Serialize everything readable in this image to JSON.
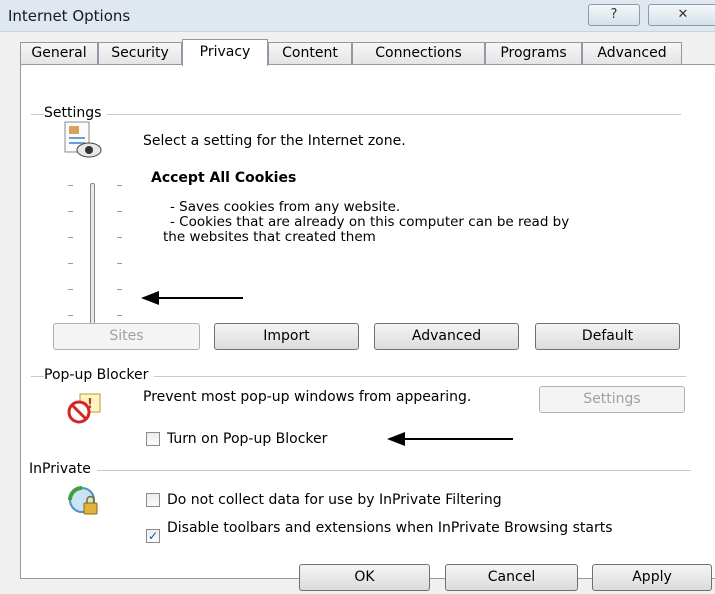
{
  "window": {
    "title": "Internet Options",
    "help_icon": "question-mark",
    "close_icon": "close-x"
  },
  "tabs": [
    "General",
    "Security",
    "Privacy",
    "Content",
    "Connections",
    "Programs",
    "Advanced"
  ],
  "active_tab": "Privacy",
  "settings": {
    "group_label": "Settings",
    "zone_prompt": "Select a setting for the Internet zone.",
    "level_title": "Accept All Cookies",
    "level_description": [
      "- Saves cookies from any website.",
      "- Cookies that are already on this computer can be read by",
      "the websites that created them"
    ],
    "slider": {
      "position": "bottom",
      "level_index": 0,
      "total_levels": 6
    },
    "buttons": {
      "sites": "Sites",
      "import": "Import",
      "advanced": "Advanced",
      "default": "Default"
    }
  },
  "popup_blocker": {
    "group_label": "Pop-up Blocker",
    "description": "Prevent most pop-up windows from appearing.",
    "settings_button": "Settings",
    "checkbox_label": "Turn on Pop-up Blocker",
    "checked": false
  },
  "inprivate": {
    "group_label": "InPrivate",
    "filtering_label": "Do not collect data for use by InPrivate Filtering",
    "filtering_checked": false,
    "toolbars_label": "Disable toolbars and extensions when InPrivate Browsing starts",
    "toolbars_checked": true
  },
  "footer": {
    "ok": "OK",
    "cancel": "Cancel",
    "apply": "Apply"
  },
  "colors": {
    "titlebar": "#dfe7f0",
    "dialog_bg": "#f0f0f0",
    "panel_bg": "#ffffff",
    "check_mark": "#1d4fa3",
    "annotation_arrow": "#000000"
  }
}
